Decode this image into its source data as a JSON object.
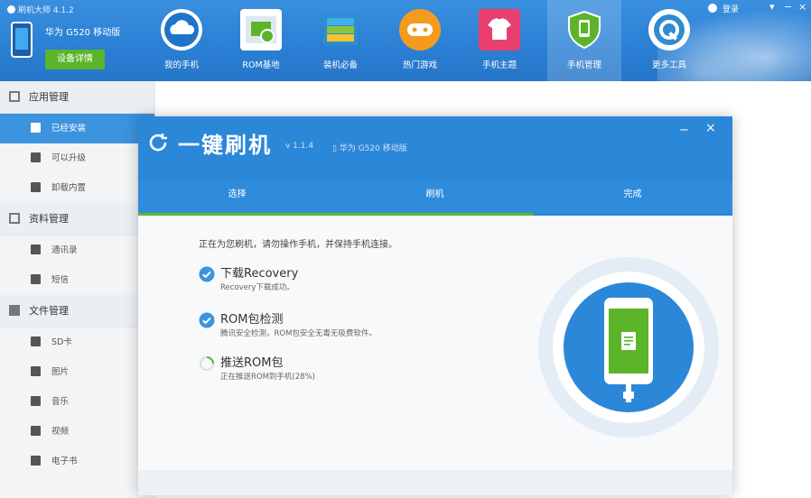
{
  "app": {
    "title": "刷机大师 4.1.2"
  },
  "device": {
    "name": "华为 G520 移动版",
    "details_button": "设备详情"
  },
  "window_controls": {
    "login": "登录"
  },
  "nav": [
    {
      "id": "my-phone",
      "label": "我的手机",
      "icon": "cloud-icon"
    },
    {
      "id": "rom",
      "label": "ROM基地",
      "icon": "rom-box-icon"
    },
    {
      "id": "essentials",
      "label": "装机必备",
      "icon": "layers-icon"
    },
    {
      "id": "games",
      "label": "热门游戏",
      "icon": "gamepad-icon"
    },
    {
      "id": "themes",
      "label": "手机主题",
      "icon": "tshirt-icon"
    },
    {
      "id": "manage",
      "label": "手机管理",
      "icon": "shield-phone-icon",
      "active": true
    },
    {
      "id": "tools",
      "label": "更多工具",
      "icon": "wrench-icon"
    }
  ],
  "sidebar": {
    "sections": [
      {
        "title": "应用管理",
        "icon": "grid-icon",
        "items": [
          {
            "label": "已经安装",
            "icon": "checkbox-icon",
            "active": true
          },
          {
            "label": "可以升级",
            "icon": "upgrade-icon"
          },
          {
            "label": "卸载内置",
            "icon": "trash-icon"
          }
        ]
      },
      {
        "title": "资料管理",
        "icon": "folder-icon",
        "items": [
          {
            "label": "通讯录",
            "icon": "contacts-icon"
          },
          {
            "label": "短信",
            "icon": "sms-icon"
          }
        ]
      },
      {
        "title": "文件管理",
        "icon": "file-icon",
        "items": [
          {
            "label": "SD卡",
            "icon": "sdcard-icon"
          },
          {
            "label": "图片",
            "icon": "image-icon"
          },
          {
            "label": "音乐",
            "icon": "music-icon"
          },
          {
            "label": "视频",
            "icon": "video-icon"
          },
          {
            "label": "电子书",
            "icon": "ebook-icon"
          }
        ]
      }
    ]
  },
  "dialog": {
    "title": "一键刷机",
    "version": "v 1.1.4",
    "device": "华为 G520 移动版",
    "steps": [
      "选择",
      "刷机",
      "完成"
    ],
    "progress_fraction": 0.665,
    "intro": "正在为您刷机，请勿操作手机，并保持手机连接。",
    "tasks": [
      {
        "name": "下载Recovery",
        "desc": "Recovery下载成功。",
        "status": "done"
      },
      {
        "name": "ROM包检测",
        "desc": "腾讯安全检测，ROM包安全无毒无吸费软件。",
        "status": "done"
      },
      {
        "name": "推送ROM包",
        "desc": "正在推送ROM到手机(28%)",
        "status": "in-progress"
      }
    ]
  },
  "colors": {
    "brand_blue": "#2b87d8",
    "accent_green": "#5cb42a",
    "check_blue": "#3c93de"
  }
}
